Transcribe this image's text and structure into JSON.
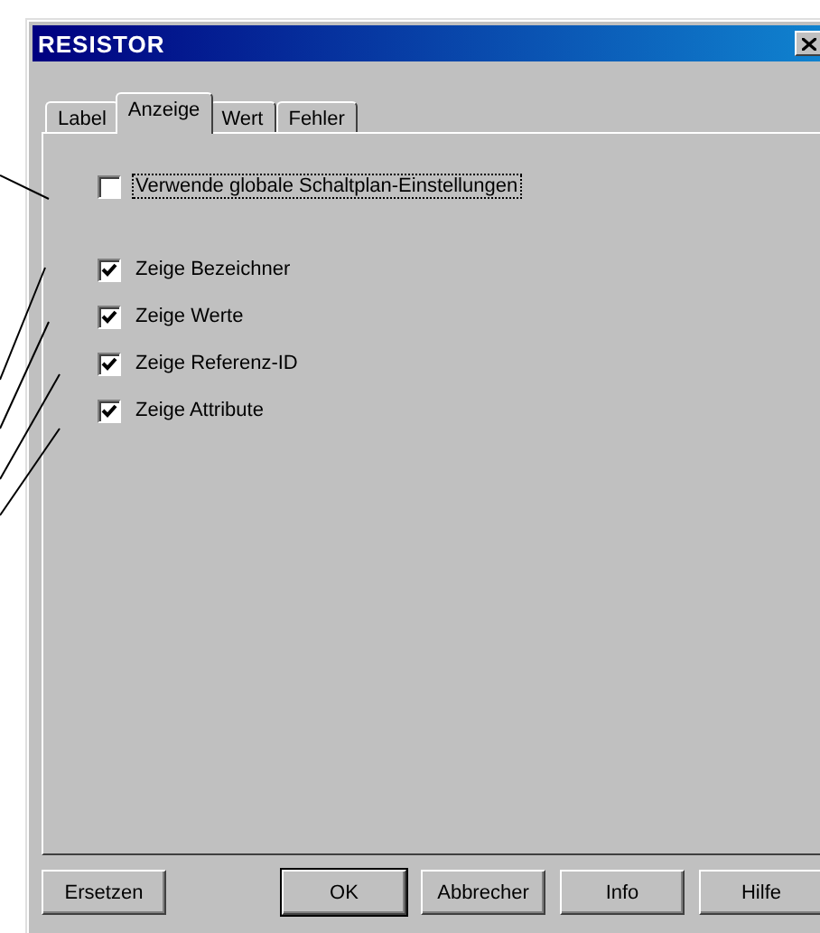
{
  "window": {
    "title": "RESISTOR"
  },
  "tabs": [
    {
      "label": "Label",
      "selected": false
    },
    {
      "label": "Anzeige",
      "selected": true
    },
    {
      "label": "Wert",
      "selected": false
    },
    {
      "label": "Fehler",
      "selected": false
    }
  ],
  "options": [
    {
      "label": "Verwende globale Schaltplan-Einstellungen",
      "checked": false,
      "focused": true,
      "kind": "global"
    },
    {
      "label": "Zeige Bezeichner",
      "checked": true,
      "focused": false,
      "kind": "show"
    },
    {
      "label": "Zeige Werte",
      "checked": true,
      "focused": false,
      "kind": "show"
    },
    {
      "label": "Zeige Referenz-ID",
      "checked": true,
      "focused": false,
      "kind": "show"
    },
    {
      "label": "Zeige Attribute",
      "checked": true,
      "focused": false,
      "kind": "show"
    }
  ],
  "buttons": [
    {
      "label": "Ersetzen",
      "default": false
    },
    {
      "label": "OK",
      "default": true
    },
    {
      "label": "Abbrecher",
      "default": false
    },
    {
      "label": "Info",
      "default": false
    },
    {
      "label": "Hilfe",
      "default": false
    }
  ]
}
